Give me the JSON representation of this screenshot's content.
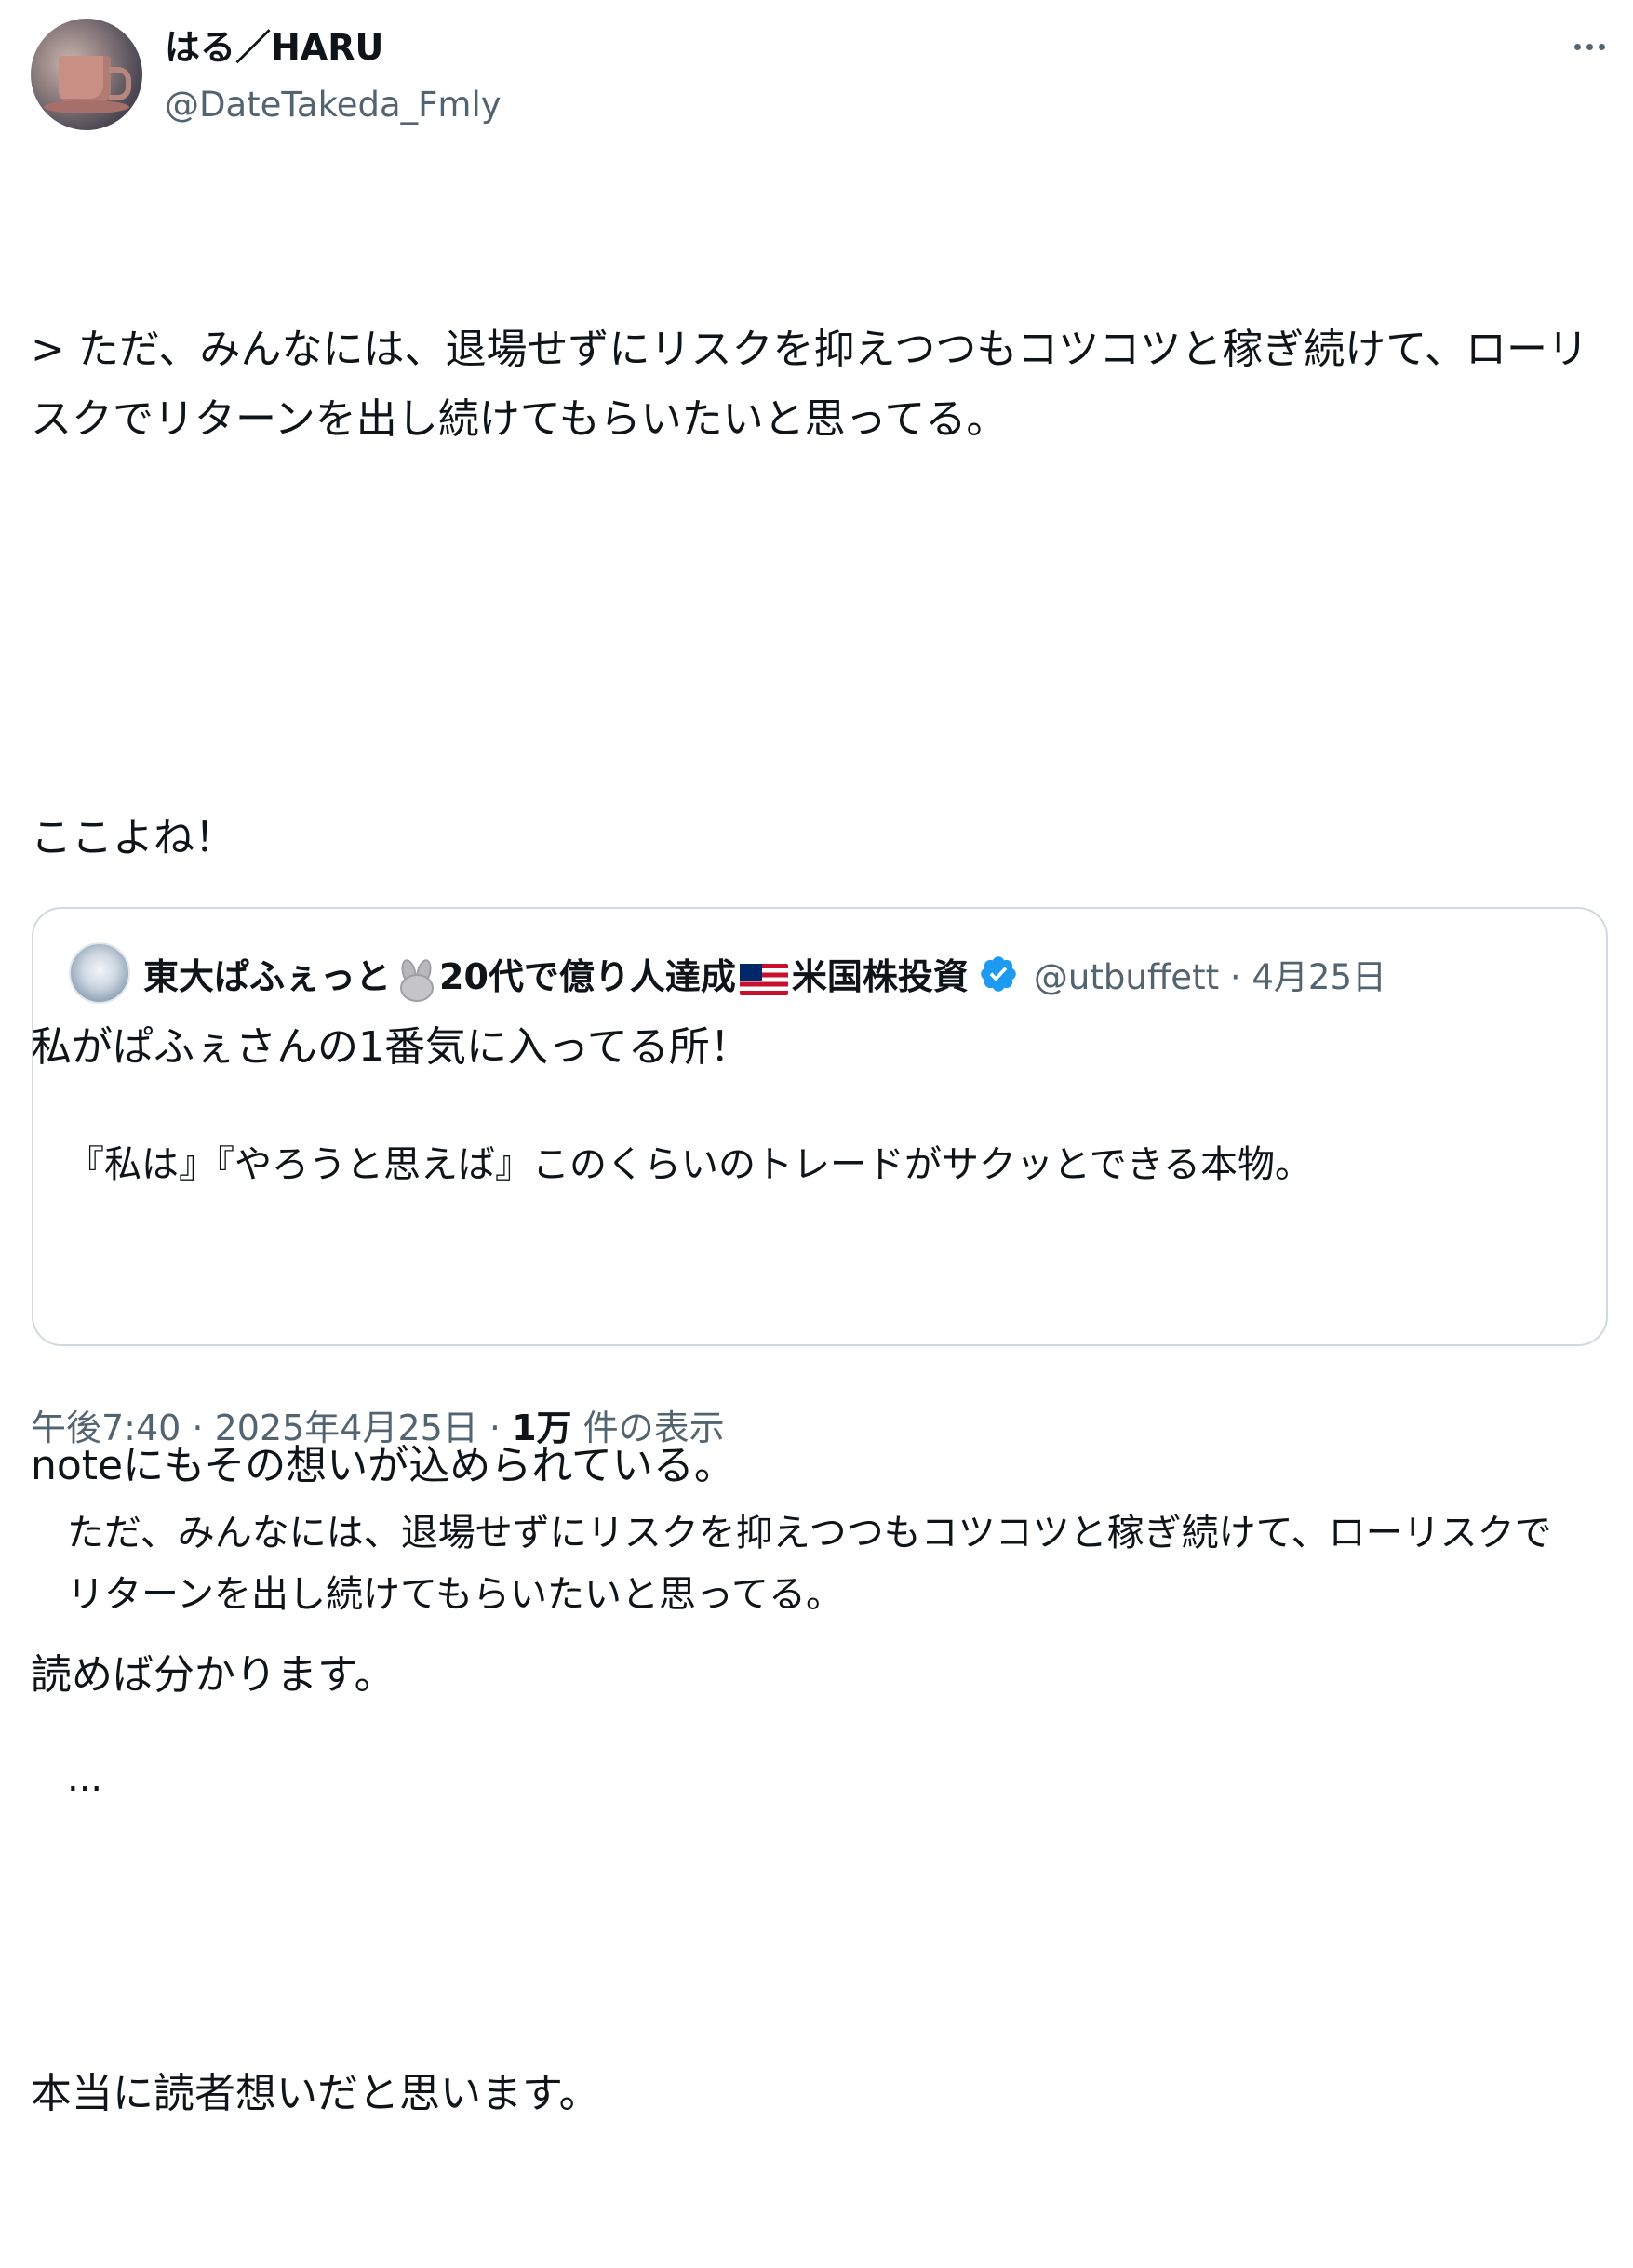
{
  "author": {
    "display_name": "はる／HARU",
    "handle": "@DateTakeda_Fmly"
  },
  "tweet": {
    "paragraphs": [
      [
        "> ただ、みんなには、退場せずにリスクを抑えつつもコツコツと稼ぎ続けて、ローリスクでリターンを出し続けてもらいたいと思ってる。"
      ],
      [
        "ここよね！",
        "私がぱふぇさんの1番気に入ってる所！"
      ],
      [
        "noteにもその想いが込められている。",
        "読めば分かります。"
      ],
      [
        "本当に読者想いだと思います。"
      ]
    ]
  },
  "quote": {
    "name_part1": "東大ぱふぇっと",
    "name_part2": "20代で億り人達成",
    "name_part3": "米国株投資",
    "handle": "@utbuffett",
    "separator": " · ",
    "date": "4月25日",
    "paragraphs": [
      "『私は』『やろうと思えば』このくらいのトレードがサクッとできる本物。",
      "ただ、みんなには、退場せずにリスクを抑えつつもコツコツと稼ぎ続けて、ローリスクでリターンを出し続けてもらいたいと思ってる。",
      "..."
    ]
  },
  "footer": {
    "time": "午後7:40",
    "sep1": " · ",
    "date": "2025年4月25日",
    "sep2": " · ",
    "views_count": "1万",
    "views_label": " 件の表示"
  },
  "icons": {
    "more": "more-dots-icon",
    "rabbit": "rabbit-emoji-icon",
    "flag": "us-flag-emoji-icon",
    "verified": "verified-badge-icon"
  },
  "colors": {
    "text": "#0f1419",
    "secondary": "#536471",
    "border": "#cfd9de",
    "verified": "#1d9bf0"
  }
}
